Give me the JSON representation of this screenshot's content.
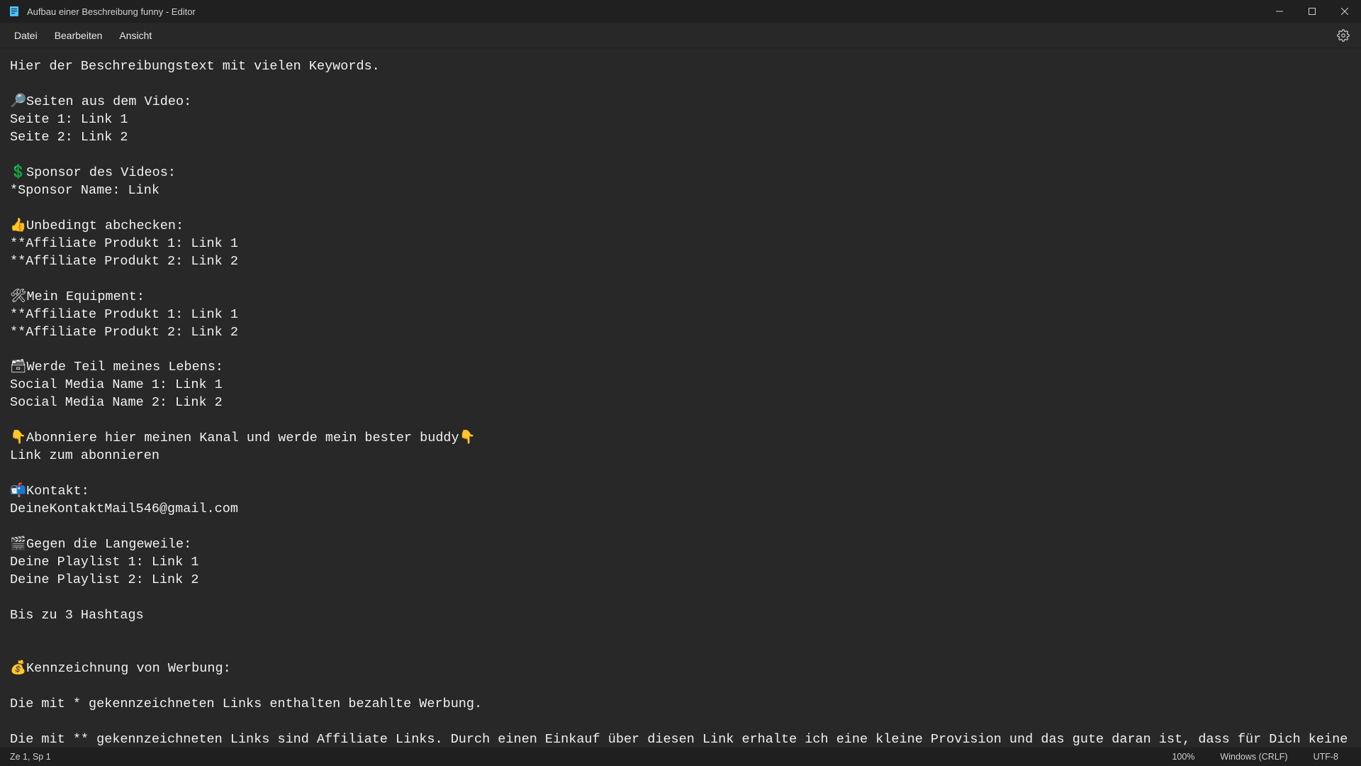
{
  "titlebar": {
    "title": "Aufbau einer Beschreibung funny - Editor"
  },
  "menu": {
    "file": "Datei",
    "edit": "Bearbeiten",
    "view": "Ansicht"
  },
  "editor": {
    "content": "Hier der Beschreibungstext mit vielen Keywords.\n\n🔎Seiten aus dem Video:\nSeite 1: Link 1\nSeite 2: Link 2\n\n💲Sponsor des Videos:\n*Sponsor Name: Link\n\n👍Unbedingt abchecken:\n**Affiliate Produkt 1: Link 1\n**Affiliate Produkt 2: Link 2\n\n🛠Mein Equipment:\n**Affiliate Produkt 1: Link 1\n**Affiliate Produkt 2: Link 2\n\n🗃Werde Teil meines Lebens:\nSocial Media Name 1: Link 1\nSocial Media Name 2: Link 2\n\n👇Abonniere hier meinen Kanal und werde mein bester buddy👇\nLink zum abonnieren\n\n📬Kontakt:\nDeineKontaktMail546@gmail.com\n\n🎬Gegen die Langeweile:\nDeine Playlist 1: Link 1\nDeine Playlist 2: Link 2\n\nBis zu 3 Hashtags\n\n\n💰Kennzeichnung von Werbung:\n\nDie mit * gekennzeichneten Links enthalten bezahlte Werbung.\n\nDie mit ** gekennzeichneten Links sind Affiliate Links. Durch einen Einkauf über diesen Link erhalte ich eine kleine Provision und das gute daran ist, dass für Dich keine zusätzlichen Kosten entstehen."
  },
  "statusbar": {
    "position": "Ze 1, Sp 1",
    "zoom": "100%",
    "line_ending": "Windows (CRLF)",
    "encoding": "UTF-8"
  }
}
